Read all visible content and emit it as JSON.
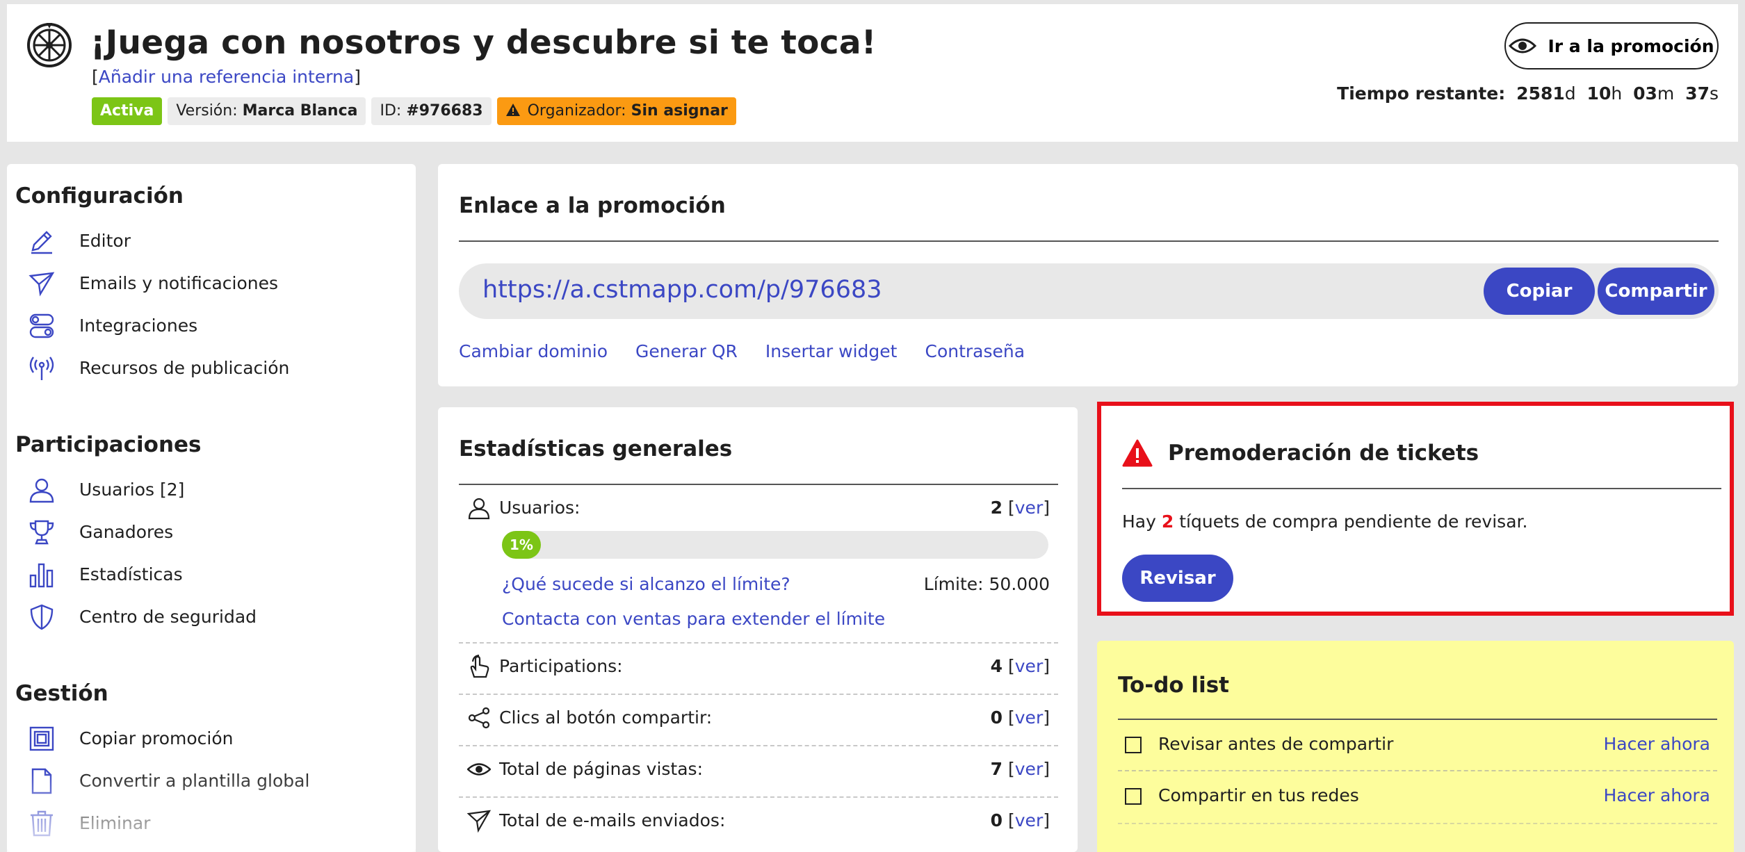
{
  "header": {
    "title": "¡Juega con nosotros y descubre si te toca!",
    "ref_open": "[",
    "ref_link": "Añadir una referencia interna",
    "ref_close": "]",
    "badges": {
      "status": "Activa",
      "version_label": "Versión:",
      "version_value": "Marca Blanca",
      "id_label": "ID:",
      "id_value": "#976683",
      "organizer_label": "Organizador:",
      "organizer_value": "Sin asignar"
    },
    "promo_button": "Ir a la promoción",
    "time": {
      "label": "Tiempo restante:",
      "days": "2581",
      "days_unit": "d",
      "hours": "10",
      "hours_unit": "h",
      "minutes": "03",
      "minutes_unit": "m",
      "seconds": "37",
      "seconds_unit": "s"
    }
  },
  "sidebar": {
    "sections": [
      {
        "title": "Configuración",
        "items": [
          {
            "label": "Editor",
            "icon": "pencil-icon"
          },
          {
            "label": "Emails y notificaciones",
            "icon": "paper-plane-icon"
          },
          {
            "label": "Integraciones",
            "icon": "toggle-icon"
          },
          {
            "label": "Recursos de publicación",
            "icon": "broadcast-icon"
          }
        ]
      },
      {
        "title": "Participaciones",
        "items": [
          {
            "label": "Usuarios [2]",
            "icon": "user-icon"
          },
          {
            "label": "Ganadores",
            "icon": "trophy-icon"
          },
          {
            "label": "Estadísticas",
            "icon": "bar-chart-icon"
          },
          {
            "label": "Centro de seguridad",
            "icon": "shield-icon"
          }
        ]
      },
      {
        "title": "Gestión",
        "items": [
          {
            "label": "Copiar promoción",
            "icon": "copy-icon"
          },
          {
            "label": "Convertir a plantilla global",
            "icon": "document-icon"
          },
          {
            "label": "Eliminar",
            "icon": "trash-icon"
          }
        ]
      }
    ]
  },
  "link_panel": {
    "title": "Enlace a la promoción",
    "url": "https://a.cstmapp.com/p/976683",
    "copy_button": "Copiar",
    "share_button": "Compartir",
    "links": [
      "Cambiar dominio",
      "Generar QR",
      "Insertar widget",
      "Contraseña"
    ]
  },
  "stats_panel": {
    "title": "Estadísticas generales",
    "users": {
      "label": "Usuarios:",
      "value": "2",
      "see": "ver"
    },
    "progress": {
      "percent": 1,
      "text": "1%"
    },
    "limit_question": "¿Qué sucede si alcanzo el límite?",
    "limit_value": "Límite: 50.000",
    "contact_sales": "Contacta con ventas para extender el límite",
    "rows": [
      {
        "label": "Participations:",
        "value": "4",
        "see": "ver",
        "icon": "hand-icon"
      },
      {
        "label": "Clics al botón compartir:",
        "value": "0",
        "see": "ver",
        "icon": "share-icon"
      },
      {
        "label": "Total de páginas vistas:",
        "value": "7",
        "see": "ver",
        "icon": "eye-icon"
      },
      {
        "label": "Total de e-mails enviados:",
        "value": "0",
        "see": "ver",
        "icon": "paper-plane-icon"
      }
    ]
  },
  "moderation_panel": {
    "title": "Premoderación de tickets",
    "text_before": "Hay",
    "count": "2",
    "text_after": "tíquets de compra pendiente de revisar.",
    "button": "Revisar",
    "highlight_color": "#e8101a"
  },
  "todo_panel": {
    "title": "To-do list",
    "items": [
      {
        "label": "Revisar antes de compartir",
        "action": "Hacer ahora"
      },
      {
        "label": "Compartir en tus redes",
        "action": "Hacer ahora"
      }
    ]
  },
  "colors": {
    "accent": "#3b47c4",
    "active_green": "#7cc516",
    "organizer_orange": "#fb9a12",
    "todo_yellow": "#fdfd9c",
    "alert_red": "#e8101a"
  }
}
